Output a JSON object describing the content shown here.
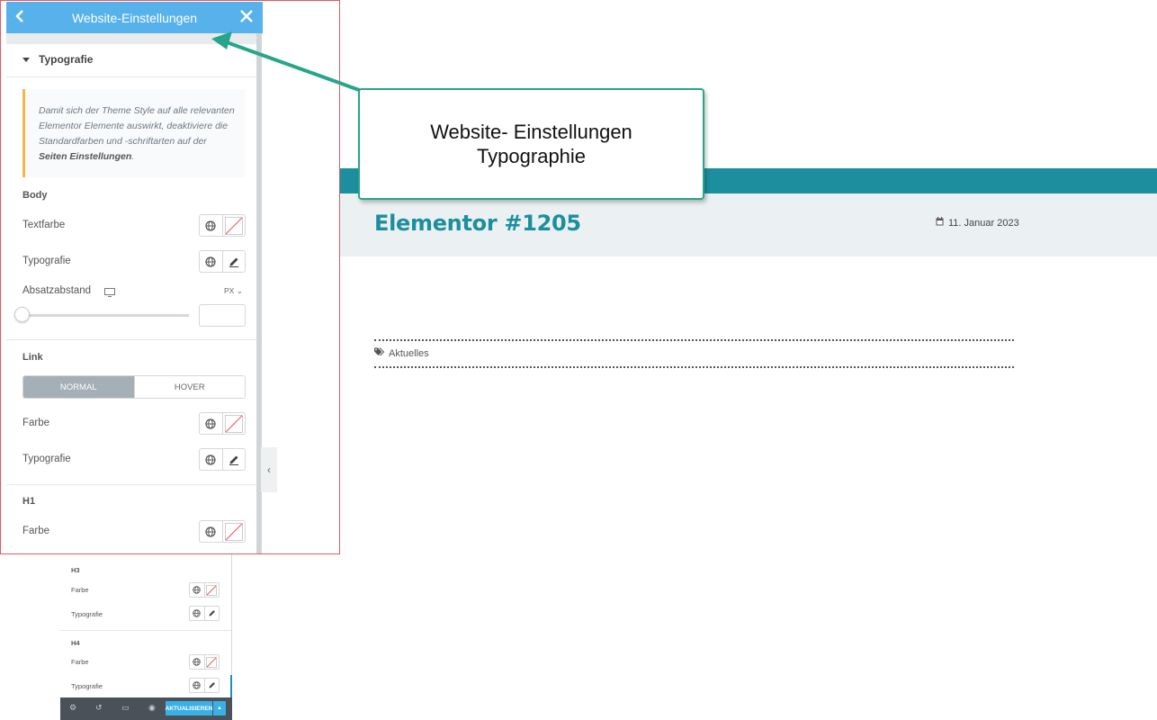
{
  "panel": {
    "title": "Website-Einstellungen",
    "section_title": "Typografie",
    "notice_text_1": "Damit sich der Theme Style auf alle relevanten Elementor Elemente auswirkt, deaktiviere die Standardfarben und -schriftarten auf der ",
    "notice_link": "Seiten Einstellungen",
    "notice_text_2": ".",
    "body_heading": "Body",
    "body_text_color_label": "Textfarbe",
    "body_typography_label": "Typografie",
    "paragraph_spacing_label": "Absatzabstand",
    "paragraph_spacing_unit": "PX",
    "paragraph_spacing_value": "",
    "link_heading": "Link",
    "tab_normal": "NORMAL",
    "tab_hover": "HOVER",
    "link_color_label": "Farbe",
    "link_typography_label": "Typografie",
    "h1_heading": "H1",
    "h1_color_label": "Farbe"
  },
  "mini_panel": {
    "h3_heading": "H3",
    "h3_color_label": "Farbe",
    "h3_typography_label": "Typografie",
    "h4_heading": "H4",
    "h4_color_label": "Farbe",
    "h4_typography_label": "Typografie",
    "update_label": "AKTUALISIEREN"
  },
  "callout": {
    "line1": "Website- Einstellungen",
    "line2": "Typographie"
  },
  "preview": {
    "post_title": "Elementor #1205",
    "post_date": "11. Januar 2023",
    "tag": "Aktuelles"
  },
  "colors": {
    "panel_header": "#57b2ec",
    "teal": "#1c8f9e",
    "callout_border": "#27a58a",
    "panel_outline": "#e25a5e",
    "notice_border": "#f0b849"
  }
}
